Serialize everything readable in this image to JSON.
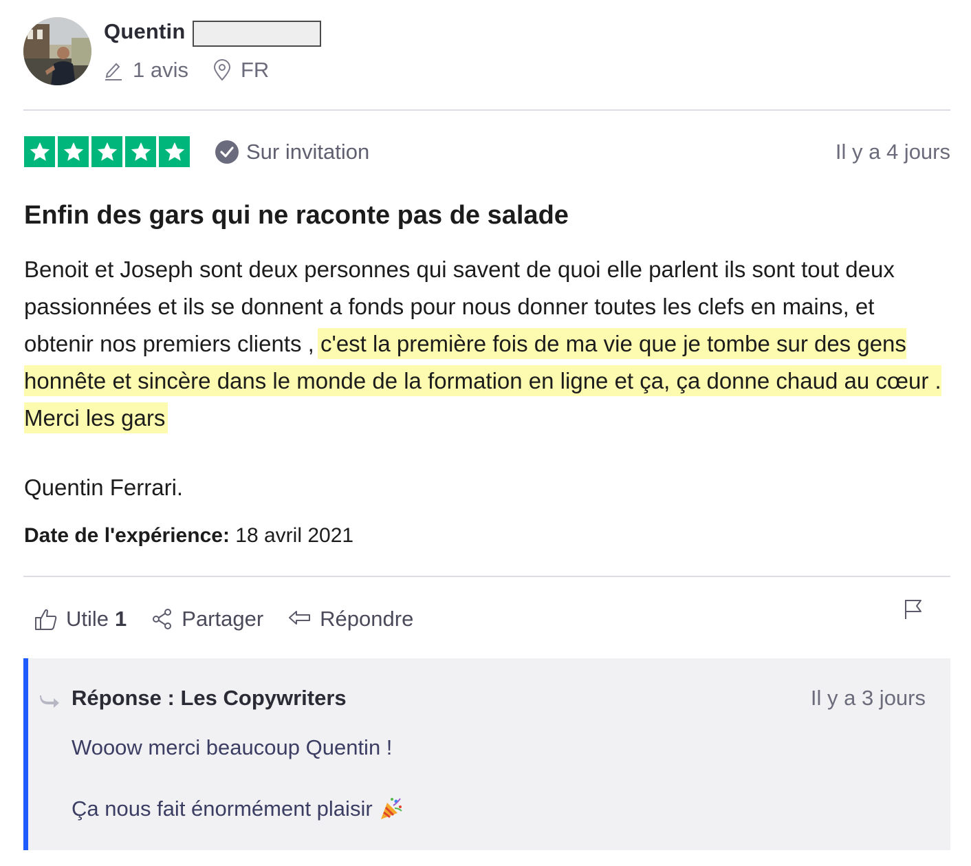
{
  "reviewer": {
    "name": "Quentin",
    "review_count": "1 avis",
    "country": "FR"
  },
  "rating": {
    "stars": 5,
    "max_stars": 5,
    "star_color": "#00b67a",
    "verification_label": "Sur invitation",
    "posted_ago": "Il y a 4 jours"
  },
  "review": {
    "title": "Enfin des gars qui ne raconte pas de salade",
    "body_plain": "Benoit et Joseph sont deux personnes qui savent de quoi elle parlent ils sont tout deux passionnées et ils se donnent a fonds pour nous donner toutes les clefs en mains, et obtenir nos premiers clients , ",
    "body_highlighted": "c'est la première fois de ma vie que je tombe sur des gens honnête et sincère dans le monde de la formation en ligne et ça, ça donne chaud au cœur . Merci les gars ",
    "highlight_color": "#fdfbb0",
    "signature": "Quentin Ferrari.",
    "experience_date_label": "Date de l'expérience:",
    "experience_date": "18 avril 2021"
  },
  "actions": {
    "useful_label": "Utile",
    "useful_count": "1",
    "share_label": "Partager",
    "reply_label": "Répondre"
  },
  "reply": {
    "heading": "Réponse : Les Copywriters",
    "posted_ago": "Il y a 3 jours",
    "line1": "Wooow merci beaucoup Quentin !",
    "line2": "Ça nous fait énormément plaisir",
    "accent_color": "#1f5cff"
  }
}
